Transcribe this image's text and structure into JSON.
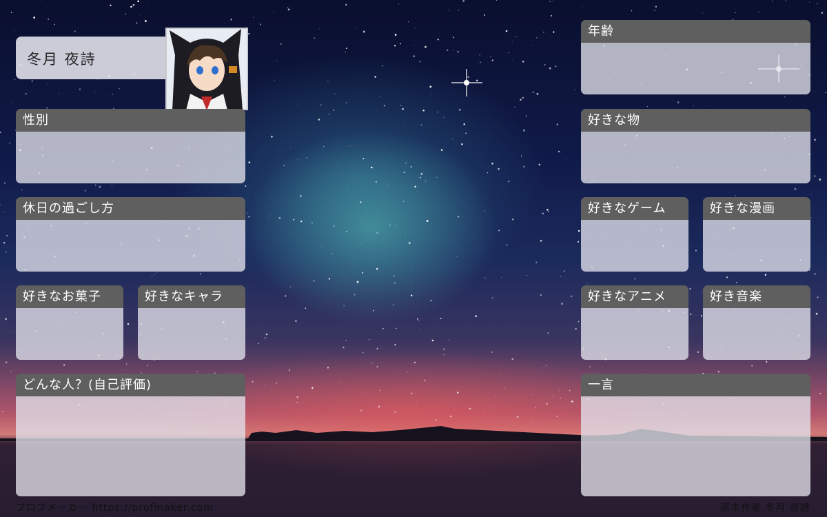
{
  "profile": {
    "name": "冬月 夜詩"
  },
  "panels": {
    "gender": "性別",
    "holiday": "休日の過ごし方",
    "snack": "好きなお菓子",
    "character": "好きなキャラ",
    "self_eval": "どんな人？(自己評価)",
    "age": "年齢",
    "likes": "好きな物",
    "game": "好きなゲーム",
    "manga": "好きな漫画",
    "anime": "好きなアニメ",
    "music": "好き音楽",
    "comment": "一言"
  },
  "footer": {
    "left": "プロフメーカー https://profmaker.com",
    "right": "原本作者 冬月 夜詩"
  }
}
